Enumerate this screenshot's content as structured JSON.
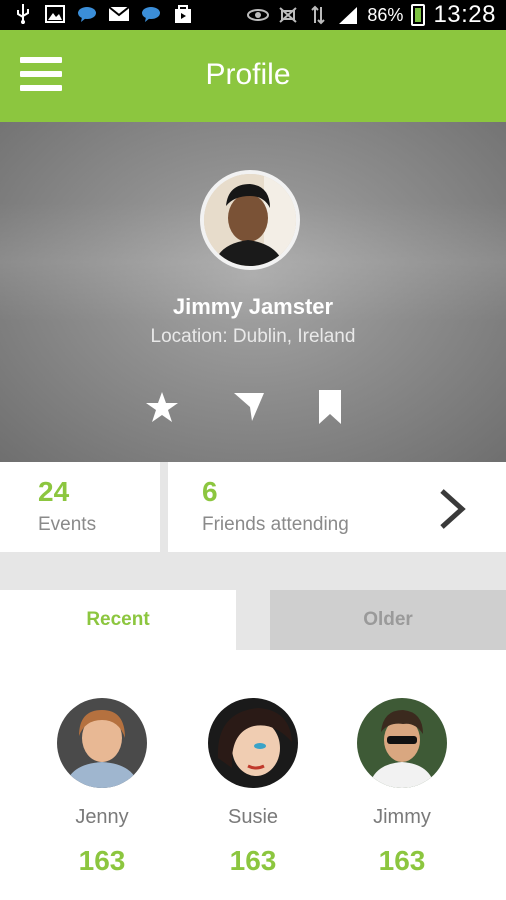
{
  "status_bar": {
    "battery": "86%",
    "time": "13:28",
    "icons": [
      "usb-icon",
      "image-icon",
      "chat-icon",
      "gmail-icon",
      "chat-icon",
      "bag-icon",
      "eye-icon",
      "mute-icon",
      "data-icon",
      "signal-icon",
      "battery-icon"
    ]
  },
  "app_bar": {
    "title": "Profile",
    "color": "#8cc63f",
    "menu_icon": "hamburger-icon"
  },
  "profile": {
    "name": "Jimmy Jamster",
    "location": "Location: Dublin, Ireland",
    "actions": [
      "star-icon",
      "filter-icon",
      "bookmark-icon"
    ]
  },
  "stats": {
    "events": {
      "count": "24",
      "label": "Events"
    },
    "friends": {
      "count": "6",
      "label": "Friends attending"
    }
  },
  "tabs": [
    {
      "label": "Recent",
      "active": true
    },
    {
      "label": "Older",
      "active": false
    }
  ],
  "people": [
    {
      "name": "Jenny",
      "count": "163"
    },
    {
      "name": "Susie",
      "count": "163"
    },
    {
      "name": "Jimmy",
      "count": "163"
    }
  ]
}
